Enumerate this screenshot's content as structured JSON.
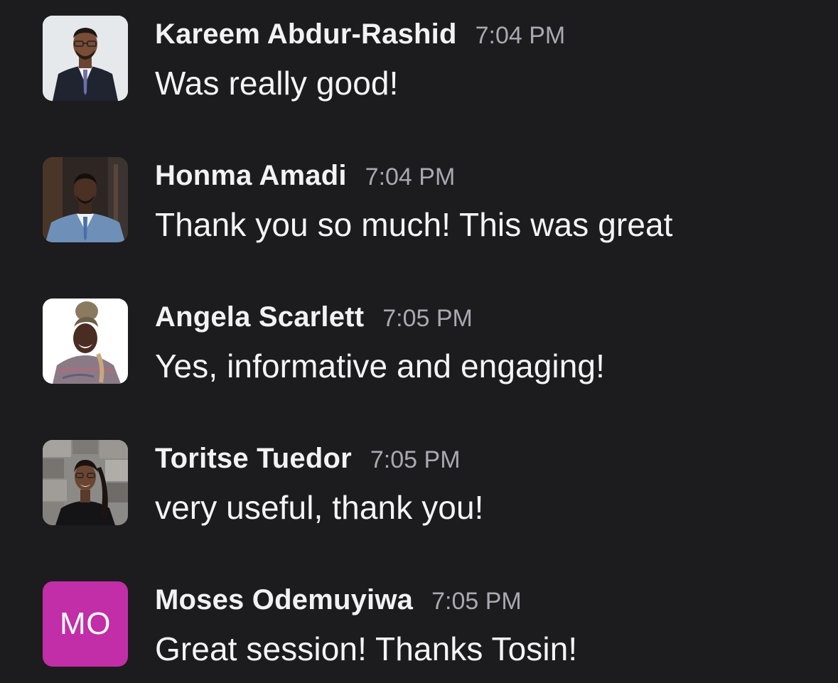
{
  "colors": {
    "background": "#1c1b1e",
    "author_text": "#f2f2f4",
    "timestamp_text": "#a9a9b0",
    "message_text": "#f4f4f6",
    "initials_avatar": "#c12ea8"
  },
  "messages": [
    {
      "author": "Kareem Abdur-Rashid",
      "time": "7:04 PM",
      "text": "Was really good!",
      "avatar": "photo"
    },
    {
      "author": "Honma Amadi",
      "time": "7:04 PM",
      "text": "Thank you so much! This was great",
      "avatar": "photo"
    },
    {
      "author": "Angela Scarlett",
      "time": "7:05 PM",
      "text": "Yes, informative and engaging!",
      "avatar": "photo"
    },
    {
      "author": "Toritse Tuedor",
      "time": "7:05 PM",
      "text": "very useful, thank you!",
      "avatar": "photo"
    },
    {
      "author": "Moses Odemuyiwa",
      "time": "7:05 PM",
      "text": "Great session! Thanks Tosin!",
      "avatar": "initials",
      "initials": "MO"
    }
  ]
}
